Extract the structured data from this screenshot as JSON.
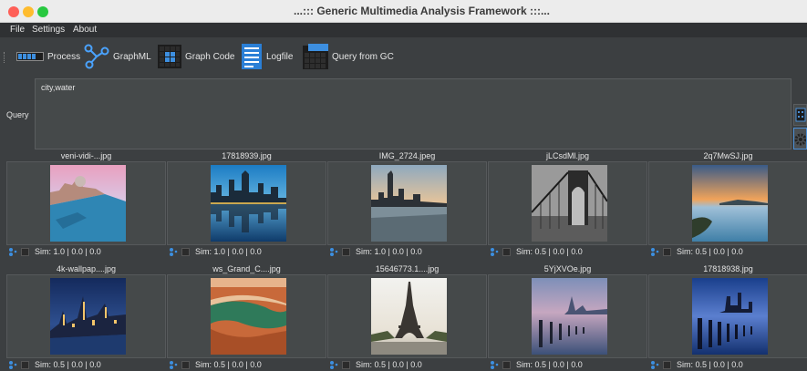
{
  "window": {
    "title": "...::: Generic Multimedia Analysis Framework :::..."
  },
  "menu": {
    "items": [
      "File",
      "Settings",
      "About"
    ]
  },
  "toolbar": {
    "process_label": "Process",
    "graphml_label": "GraphML",
    "graphcode_label": "Graph Code",
    "logfile_label": "Logfile",
    "query_gc_label": "Query from GC"
  },
  "query": {
    "label": "Query",
    "value": "city,water"
  },
  "results": [
    {
      "name": "veni-vidi-...jpg",
      "sim": "Sim: 1.0 | 0.0 | 0.0",
      "icon": "venice-canal-photo"
    },
    {
      "name": "17818939.jpg",
      "sim": "Sim: 1.0 | 0.0 | 0.0",
      "icon": "city-skyline-reflection-photo"
    },
    {
      "name": "IMG_2724.jpeg",
      "sim": "Sim: 1.0 | 0.0 | 0.0",
      "icon": "lakeside-skyline-photo"
    },
    {
      "name": "jLCsdMl.jpg",
      "sim": "Sim: 0.5 | 0.0 | 0.0",
      "icon": "bridge-bw-photo"
    },
    {
      "name": "2q7MwSJ.jpg",
      "sim": "Sim: 0.5 | 0.0 | 0.0",
      "icon": "bay-sunset-photo"
    },
    {
      "name": "4k-wallpap....jpg",
      "sim": "Sim: 0.5 | 0.0 | 0.0",
      "icon": "harbor-night-photo"
    },
    {
      "name": "ws_Grand_C....jpg",
      "sim": "Sim: 0.5 | 0.0 | 0.0",
      "icon": "canyon-river-photo"
    },
    {
      "name": "15646773.1....jpg",
      "sim": "Sim: 0.5 | 0.0 | 0.0",
      "icon": "eiffel-tower-photo"
    },
    {
      "name": "5YjXVOe.jpg",
      "sim": "Sim: 0.5 | 0.0 | 0.0",
      "icon": "pier-posts-dusk-photo"
    },
    {
      "name": "17818938.jpg",
      "sim": "Sim: 0.5 | 0.0 | 0.0",
      "icon": "pier-posts-night-photo"
    }
  ],
  "colors": {
    "background": "#3c3f41",
    "accent": "#4b8fd6",
    "text": "#e4e4e4"
  }
}
